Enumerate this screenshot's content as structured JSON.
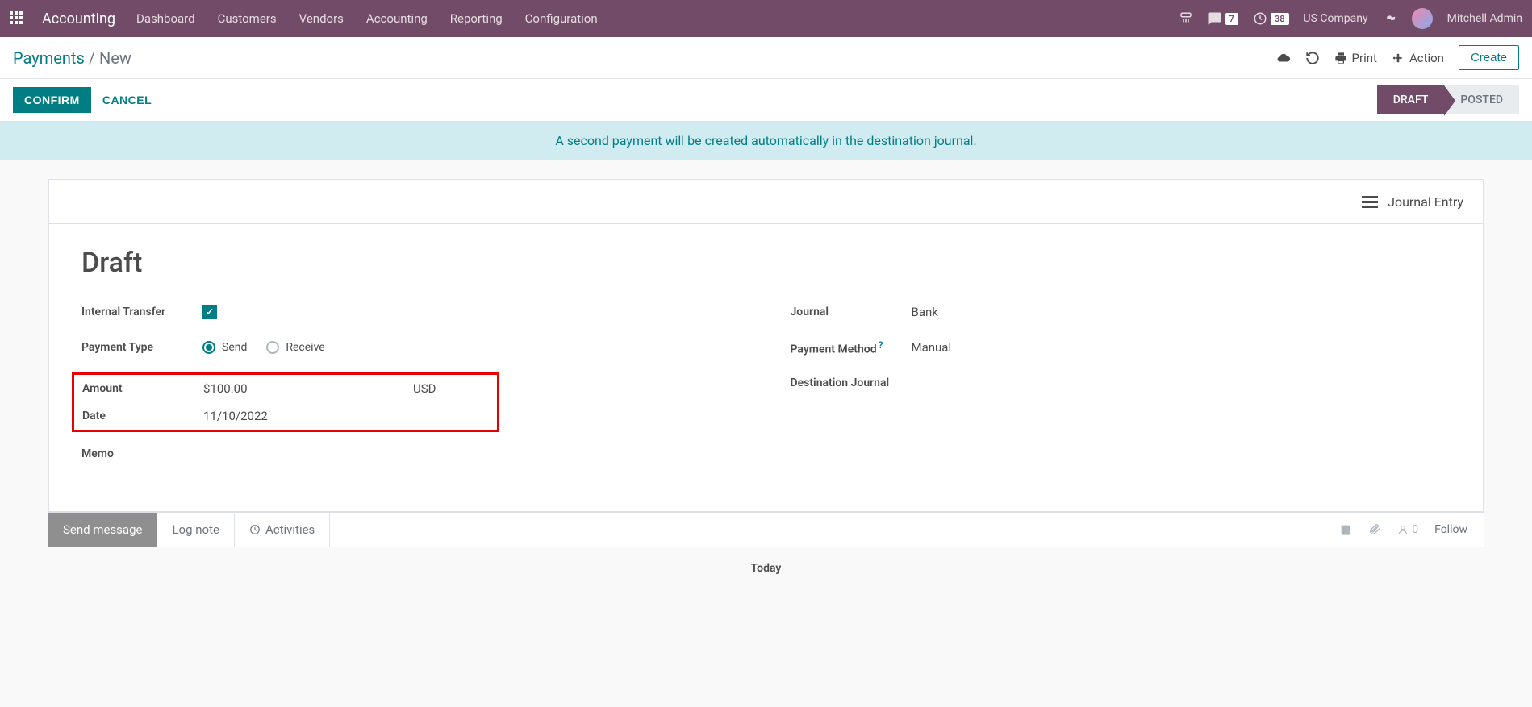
{
  "navbar": {
    "brand": "Accounting",
    "menu": [
      "Dashboard",
      "Customers",
      "Vendors",
      "Accounting",
      "Reporting",
      "Configuration"
    ],
    "messages_count": "7",
    "activities_count": "38",
    "company": "US Company",
    "username": "Mitchell Admin"
  },
  "breadcrumb": {
    "parent": "Payments",
    "current": "New"
  },
  "controls": {
    "print": "Print",
    "action": "Action",
    "create": "Create"
  },
  "statusbar": {
    "confirm": "CONFIRM",
    "cancel": "CANCEL",
    "steps": {
      "draft": "DRAFT",
      "posted": "POSTED"
    }
  },
  "banner": "A second payment will be created automatically in the destination journal.",
  "stat_buttons": {
    "journal_entry": "Journal Entry"
  },
  "record": {
    "title": "Draft",
    "labels": {
      "internal_transfer": "Internal Transfer",
      "payment_type": "Payment Type",
      "amount": "Amount",
      "date": "Date",
      "memo": "Memo",
      "journal": "Journal",
      "payment_method": "Payment Method",
      "destination_journal": "Destination Journal"
    },
    "values": {
      "send": "Send",
      "receive": "Receive",
      "amount": "$100.00",
      "currency": "USD",
      "date": "11/10/2022",
      "memo": "",
      "journal": "Bank",
      "payment_method": "Manual",
      "destination_journal": ""
    }
  },
  "chatter": {
    "send_message": "Send message",
    "log_note": "Log note",
    "activities": "Activities",
    "followers_count": "0",
    "follow": "Follow",
    "today": "Today"
  }
}
